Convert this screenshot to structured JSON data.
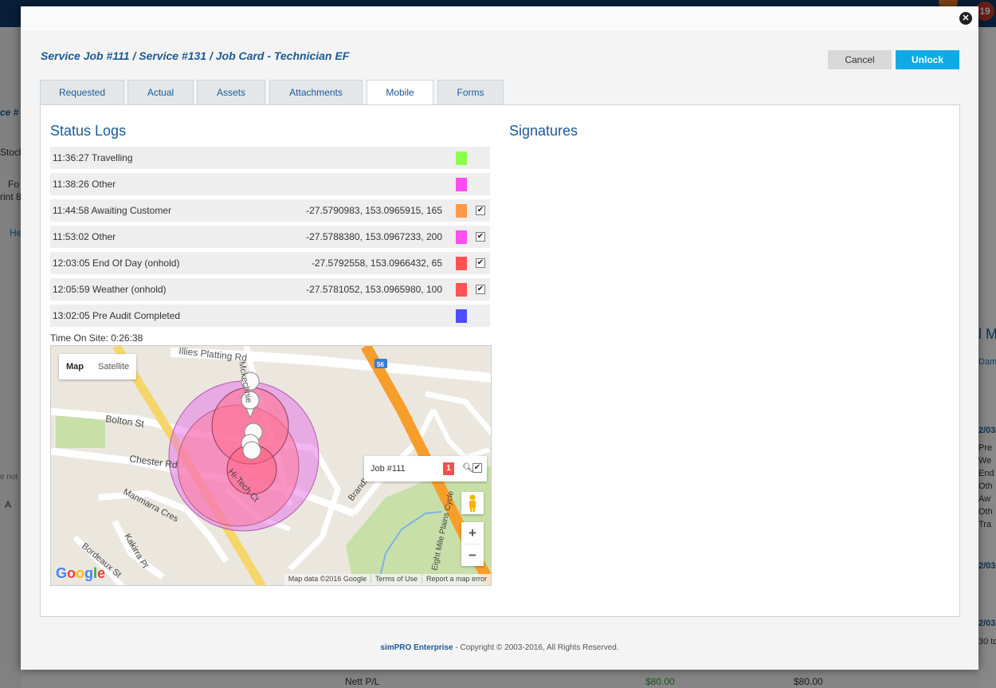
{
  "background": {
    "notification_count": "19",
    "left_fragments": [
      "ce #",
      "Stock",
      "Fo",
      "rint 8",
      "He",
      "e not",
      "A"
    ],
    "right_fragments": [
      "l M",
      "Dama",
      "2/03",
      "Pre",
      "We",
      "End",
      "Oth",
      "Aw",
      "Oth",
      "Tra",
      "2/03",
      "2/03",
      "30 to"
    ],
    "bottom_label": "Nett P/L",
    "bottom_value_1": "$80.00",
    "bottom_value_2": "$80.00"
  },
  "modal": {
    "title": "Service Job #111 / Service #131 / Job Card - Technician EF",
    "cancel_label": "Cancel",
    "unlock_label": "Unlock",
    "close_glyph": "✕"
  },
  "tabs": [
    {
      "label": "Requested"
    },
    {
      "label": "Actual"
    },
    {
      "label": "Assets"
    },
    {
      "label": "Attachments"
    },
    {
      "label": "Mobile"
    },
    {
      "label": "Forms"
    }
  ],
  "status_logs": {
    "title": "Status Logs",
    "rows": [
      {
        "label": "11:36:27 Travelling",
        "coords": "",
        "color": "#8cff4a",
        "checked": false
      },
      {
        "label": "11:38:26 Other",
        "coords": "",
        "color": "#ff4df0",
        "checked": false
      },
      {
        "label": "11:44:58 Awaiting Customer",
        "coords": "-27.5790983, 153.0965915, 165",
        "color": "#ff9a4a",
        "checked": true
      },
      {
        "label": "11:53:02 Other",
        "coords": "-27.5788380, 153.0967233, 200",
        "color": "#ff4df0",
        "checked": true
      },
      {
        "label": "12:03:05 End Of Day (onhold)",
        "coords": "-27.5792558, 153.0966432, 65",
        "color": "#ff5252",
        "checked": true
      },
      {
        "label": "12:05:59 Weather (onhold)",
        "coords": "-27.5781052, 153.0965980, 100",
        "color": "#ff5252",
        "checked": true
      },
      {
        "label": "13:02:05 Pre Audit Completed",
        "coords": "",
        "color": "#4d4dff",
        "checked": false
      }
    ],
    "time_on_site": "Time On Site: 0:26:38"
  },
  "signatures": {
    "title": "Signatures"
  },
  "map": {
    "type_map": "Map",
    "type_satellite": "Satellite",
    "job_label": "Job #111",
    "job_count": "1",
    "zoom_in": "+",
    "zoom_out": "−",
    "attribution": "Map data ©2016 Google",
    "terms": "Terms of Use",
    "report": "Report a map error",
    "streets": {
      "platting": "Illies Platting Rd",
      "mckechnie": "Mckechnie",
      "bolton": "Bolton St",
      "chester": "Chester Rd",
      "manmarra": "Manmarra Cres",
      "kakirra": "Kakirra Pl",
      "bordeaux": "Bordeaux St",
      "hitech": "Hi-Tech Ct",
      "brandl": "Brandl",
      "eightmile": "Eight Mile Plains Cycle",
      "route": "56"
    }
  },
  "footer": {
    "brand": "simPRO Enterprise",
    "copyright": " - Copyright © 2003-2016, All Rights Reserved."
  }
}
